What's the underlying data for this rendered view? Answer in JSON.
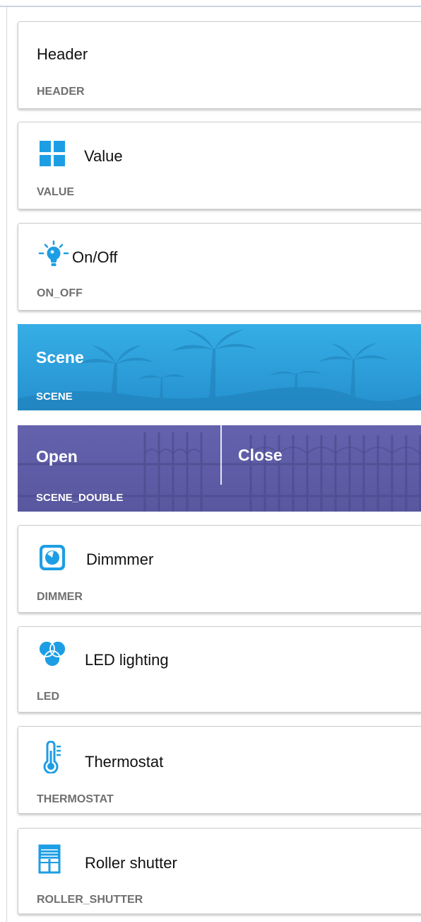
{
  "tiles": [
    {
      "title": "Header",
      "type": "HEADER"
    },
    {
      "title": "Value",
      "type": "VALUE",
      "icon": "grid-icon"
    },
    {
      "title": "On/Off",
      "type": "ON_OFF",
      "icon": "lightbulb-icon"
    },
    {
      "title": "Scene",
      "type": "SCENE",
      "background": "palm-trees-image"
    },
    {
      "open_label": "Open",
      "close_label": "Close",
      "type": "SCENE_DOUBLE",
      "background": "gate-fence-image"
    },
    {
      "title": "Dimmmer",
      "type": "DIMMER",
      "icon": "dimmer-icon"
    },
    {
      "title": "LED lighting",
      "type": "LED",
      "icon": "rgb-led-icon"
    },
    {
      "title": "Thermostat",
      "type": "THERMOSTAT",
      "icon": "thermometer-icon"
    },
    {
      "title": "Roller shutter",
      "type": "ROLLER_SHUTTER",
      "icon": "roller-shutter-icon"
    }
  ],
  "colors": {
    "icon_blue": "#1d9ee4",
    "scene_bg": "#2fa4dd",
    "scene_double_bg": "#5e5ca8",
    "type_label": "#707070"
  }
}
